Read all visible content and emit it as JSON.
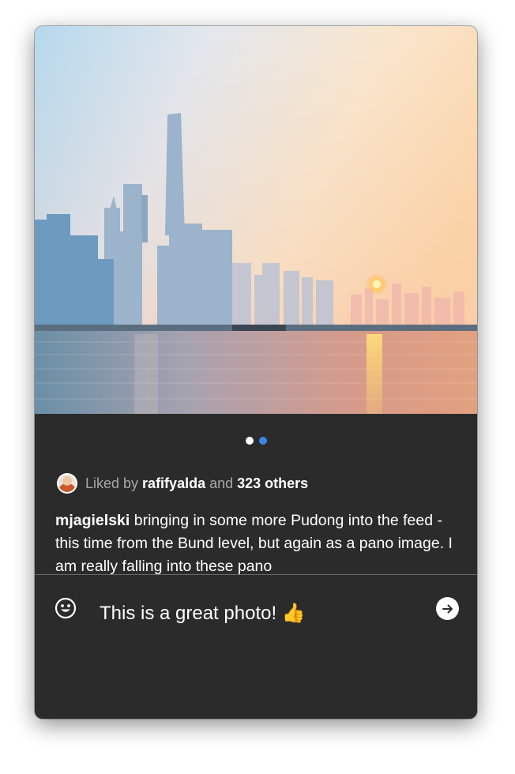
{
  "post": {
    "carousel": {
      "total_slides": 2,
      "active_index": 0
    },
    "likes": {
      "prefix": "Liked by",
      "user": "rafifyalda",
      "connector": "and",
      "others": "323 others"
    },
    "caption": {
      "username": "mjagielski",
      "text": "bringing in some more Pudong into the feed - this time from the Bund level, but again as a pano image. I am really falling into these pano"
    }
  },
  "composer": {
    "comment_value": "This is a great photo! 👍",
    "placeholder": "Add a comment…"
  },
  "icons": {
    "emoji": "smiley-icon",
    "send": "arrow-right-circle-icon"
  },
  "colors": {
    "panel_background": "#2b2b2b",
    "active_dot": "#ffffff",
    "inactive_dot": "#3d86e6",
    "muted_text": "#a8a8a8"
  }
}
